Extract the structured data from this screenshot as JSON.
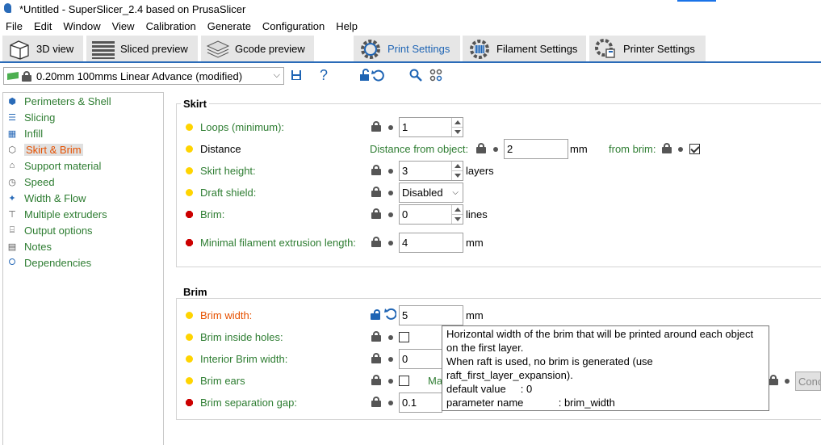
{
  "window": {
    "title": "*Untitled - SuperSlicer_2.4  based on PrusaSlicer"
  },
  "menu": [
    "File",
    "Edit",
    "Window",
    "View",
    "Calibration",
    "Generate",
    "Configuration",
    "Help"
  ],
  "tabs": [
    {
      "label": "3D view",
      "icon": "cube-icon"
    },
    {
      "label": "Sliced preview",
      "icon": "layers-icon"
    },
    {
      "label": "Gcode preview",
      "icon": "stack-icon"
    },
    {
      "label": "Print Settings",
      "icon": "print-gear-icon",
      "active": true
    },
    {
      "label": "Filament Settings",
      "icon": "filament-gear-icon"
    },
    {
      "label": "Printer Settings",
      "icon": "printer-gear-icon"
    }
  ],
  "preset": {
    "value": "0.20mm 100mms Linear Advance (modified)"
  },
  "sidebar": {
    "items": [
      {
        "label": "Perimeters & Shell",
        "icon": "shell-icon"
      },
      {
        "label": "Slicing",
        "icon": "slicing-icon"
      },
      {
        "label": "Infill",
        "icon": "infill-icon"
      },
      {
        "label": "Skirt & Brim",
        "icon": "skirt-icon",
        "selected": true
      },
      {
        "label": "Support material",
        "icon": "support-icon"
      },
      {
        "label": "Speed",
        "icon": "speed-icon"
      },
      {
        "label": "Width & Flow",
        "icon": "width-icon"
      },
      {
        "label": "Multiple extruders",
        "icon": "extruders-icon"
      },
      {
        "label": "Output options",
        "icon": "output-icon"
      },
      {
        "label": "Notes",
        "icon": "notes-icon"
      },
      {
        "label": "Dependencies",
        "icon": "dependencies-icon"
      }
    ]
  },
  "skirt": {
    "title": "Skirt",
    "loops_label": "Loops (minimum):",
    "loops_value": "1",
    "distance_label": "Distance",
    "distance_from_object_label": "Distance from object:",
    "distance_from_object_value": "2",
    "distance_unit": "mm",
    "from_brim_label": "from brim:",
    "skirt_height_label": "Skirt height:",
    "skirt_height_value": "3",
    "skirt_height_unit": "layers",
    "draft_shield_label": "Draft shield:",
    "draft_shield_value": "Disabled",
    "brim_label": "Brim:",
    "brim_value": "0",
    "brim_unit": "lines",
    "min_extrusion_label": "Minimal filament extrusion length:",
    "min_extrusion_value": "4",
    "min_extrusion_unit": "mm"
  },
  "brim": {
    "title": "Brim",
    "width_label": "Brim width:",
    "width_value": "5",
    "width_unit": "mm",
    "inside_holes_label": "Brim inside holes:",
    "interior_width_label": "Interior Brim width:",
    "interior_width_value": "0",
    "ears_label": "Brim ears",
    "ears_partial_label": "Ma",
    "separation_label": "Brim separation gap:",
    "separation_value": "0.1",
    "cond_button_label": "Conc"
  },
  "tooltip": {
    "lines": [
      "Horizontal width of the brim that will be printed around each object",
      "on the first layer.",
      "When raft is used, no brim is generated (use",
      "raft_first_layer_expansion).",
      "default value     : 0",
      "parameter name            : brim_width"
    ]
  },
  "colors": {
    "accent": "#1e64b4",
    "modified_label": "#e65100",
    "setting_label": "#2e7d32"
  }
}
